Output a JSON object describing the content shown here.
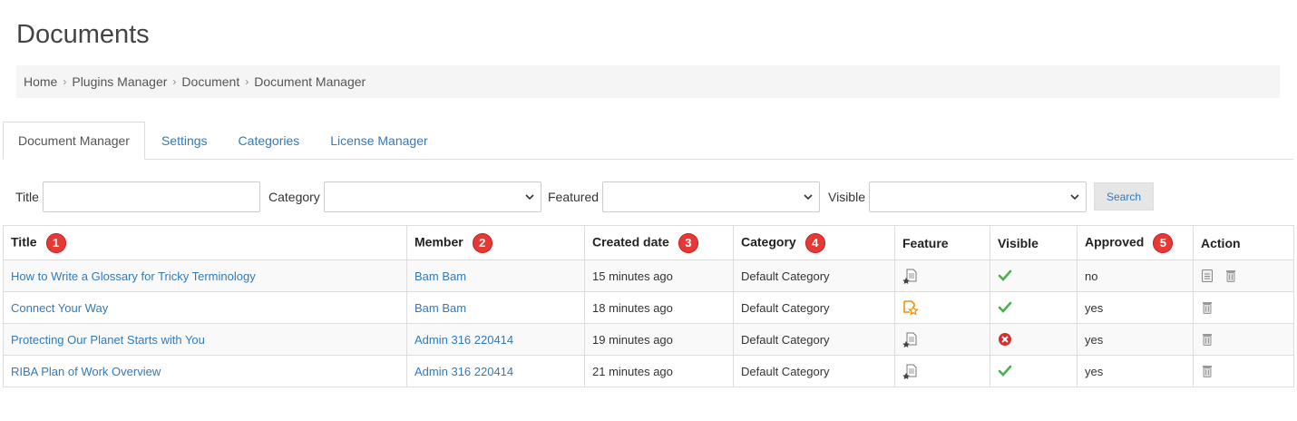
{
  "page": {
    "title": "Documents"
  },
  "breadcrumb": [
    "Home",
    "Plugins Manager",
    "Document",
    "Document Manager"
  ],
  "tabs": [
    {
      "label": "Document Manager",
      "active": true
    },
    {
      "label": "Settings",
      "active": false
    },
    {
      "label": "Categories",
      "active": false
    },
    {
      "label": "License Manager",
      "active": false
    }
  ],
  "filters": {
    "title_label": "Title",
    "category_label": "Category",
    "featured_label": "Featured",
    "visible_label": "Visible",
    "search_label": "Search"
  },
  "table": {
    "headers": [
      {
        "label": "Title",
        "badge": "1"
      },
      {
        "label": "Member",
        "badge": "2"
      },
      {
        "label": "Created date",
        "badge": "3"
      },
      {
        "label": "Category",
        "badge": "4"
      },
      {
        "label": "Feature",
        "badge": ""
      },
      {
        "label": "Visible",
        "badge": ""
      },
      {
        "label": "Approved",
        "badge": "5"
      },
      {
        "label": "Action",
        "badge": ""
      }
    ],
    "rows": [
      {
        "title": "How to Write a Glossary for Tricky Terminology",
        "member": "Bam Bam",
        "created": "15 minutes ago",
        "category": "Default Category",
        "feature_icon": "unfeatured-document-icon",
        "visible_icon": "check-icon",
        "approved": "no",
        "actions": [
          "approve-icon",
          "trash-icon"
        ]
      },
      {
        "title": "Connect Your Way",
        "member": "Bam Bam",
        "created": "18 minutes ago",
        "category": "Default Category",
        "feature_icon": "featured-document-icon",
        "visible_icon": "check-icon",
        "approved": "yes",
        "actions": [
          "trash-icon"
        ]
      },
      {
        "title": "Protecting Our Planet Starts with You",
        "member": "Admin 316 220414",
        "created": "19 minutes ago",
        "category": "Default Category",
        "feature_icon": "unfeatured-document-icon",
        "visible_icon": "cross-icon",
        "approved": "yes",
        "actions": [
          "trash-icon"
        ]
      },
      {
        "title": "RIBA Plan of Work Overview",
        "member": "Admin 316 220414",
        "created": "21 minutes ago",
        "category": "Default Category",
        "feature_icon": "unfeatured-document-icon",
        "visible_icon": "check-icon",
        "approved": "yes",
        "actions": [
          "trash-icon"
        ]
      }
    ]
  },
  "colors": {
    "link": "#337ab7",
    "badge": "#e53935",
    "check": "#4caf50",
    "cross": "#d32f2f",
    "feature": "#f0900b"
  }
}
